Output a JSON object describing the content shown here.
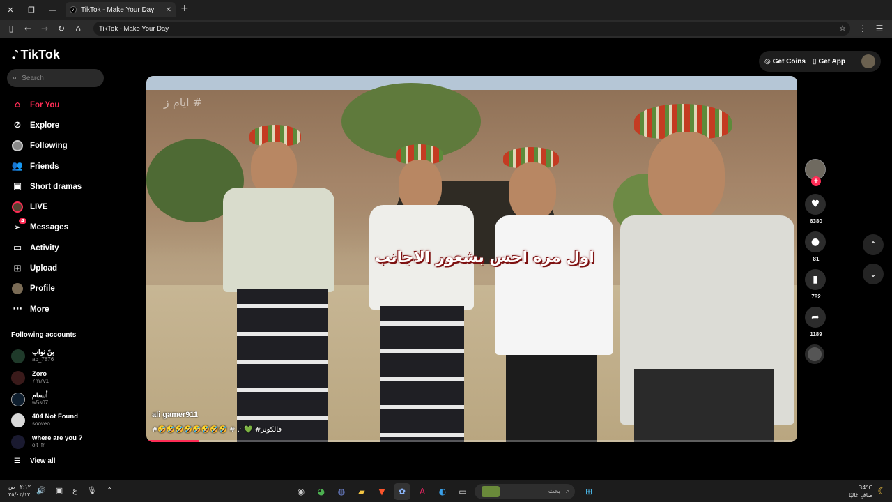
{
  "browser": {
    "tab_title": "TikTok - Make Your Day",
    "url_text": "TikTok - Make Your Day"
  },
  "sidebar": {
    "logo": "TikTok",
    "search_placeholder": "Search",
    "menu": [
      {
        "label": "For You",
        "icon": "home-icon"
      },
      {
        "label": "Explore",
        "icon": "compass-icon"
      },
      {
        "label": "Following",
        "icon": "following-avatar-icon"
      },
      {
        "label": "Friends",
        "icon": "friends-icon"
      },
      {
        "label": "Short dramas",
        "icon": "film-icon"
      },
      {
        "label": "LIVE",
        "icon": "live-avatar-icon"
      },
      {
        "label": "Messages",
        "icon": "send-icon",
        "badge": "4"
      },
      {
        "label": "Activity",
        "icon": "message-square-icon"
      },
      {
        "label": "Upload",
        "icon": "plus-square-icon"
      },
      {
        "label": "Profile",
        "icon": "profile-avatar-icon"
      },
      {
        "label": "More",
        "icon": "more-dots-icon"
      }
    ],
    "following_heading": "Following accounts",
    "accounts": [
      {
        "name": "بنّ ثواب",
        "username": "ab_7876",
        "color": "#1f3a2a"
      },
      {
        "name": "Zoro",
        "username": "7m7v1",
        "color": "#3a1a1a"
      },
      {
        "name": "أنسام",
        "username": "w5s07",
        "color": "#0e1e2e"
      },
      {
        "name": "404 Not Found",
        "username": "sooveo",
        "color": "#d9d9d9"
      },
      {
        "name": "where are you ?",
        "username": "oit_fr",
        "color": "#1a1a30"
      }
    ],
    "view_all": "View all"
  },
  "topbar": {
    "get_coins": "Get Coins",
    "get_app": "Get App"
  },
  "video": {
    "caption": "اول مره احس بشعور الاجانب",
    "watermark": "# ايام ز",
    "author": "ali gamer911",
    "description": "#🤣🤣🤣🤣🤣🤣🤣🤣 # .· 💚 #فالكونز",
    "progress": 0.08
  },
  "actions": {
    "likes": "6380",
    "comments": "81",
    "saves": "782",
    "shares": "1189"
  },
  "taskbar": {
    "time": "٠٢:١٢ ص",
    "date": "٢٥/٠٣/١٢",
    "search_placeholder": "بحث",
    "temperature": "34°C",
    "weather": "صافٍ غالبًا",
    "lang": "ع"
  }
}
